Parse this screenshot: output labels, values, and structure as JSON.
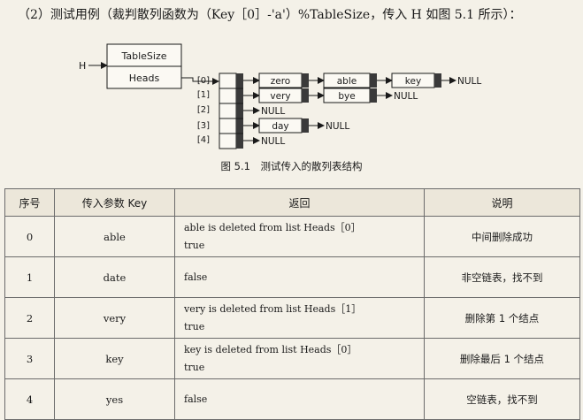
{
  "heading": "（2）测试用例（裁判散列函数为（Key［0］-'a'）%TableSize，传入 H 如图 5.1 所示）：",
  "diagram": {
    "h_label": "H",
    "tablesize_label": "TableSize",
    "heads_label": "Heads",
    "slots": [
      "[0]",
      "[1]",
      "[2]",
      "[3]",
      "[4]"
    ],
    "lists": [
      [
        "zero",
        "able",
        "key",
        "NULL"
      ],
      [
        "very",
        "bye",
        "NULL"
      ],
      [
        "NULL"
      ],
      [
        "day",
        "NULL"
      ],
      [
        "NULL"
      ]
    ]
  },
  "caption": "图 5.1　测试传入的散列表结构",
  "table": {
    "headers": [
      "序号",
      "传入参数 Key",
      "返回",
      "说明"
    ],
    "rows": [
      {
        "num": "0",
        "key": "able",
        "ret1": "able is deleted from list Heads［0］",
        "ret2": "true",
        "note": "中间删除成功"
      },
      {
        "num": "1",
        "key": "date",
        "ret1": "false",
        "ret2": "",
        "note": "非空链表，找不到"
      },
      {
        "num": "2",
        "key": "very",
        "ret1": "very is deleted from list Heads［1］",
        "ret2": "true",
        "note": "删除第 1 个结点"
      },
      {
        "num": "3",
        "key": "key",
        "ret1": "key is deleted from list Heads［0］",
        "ret2": "true",
        "note": "删除最后 1 个结点"
      },
      {
        "num": "4",
        "key": "yes",
        "ret1": "false",
        "ret2": "",
        "note": "空链表，找不到"
      }
    ]
  }
}
